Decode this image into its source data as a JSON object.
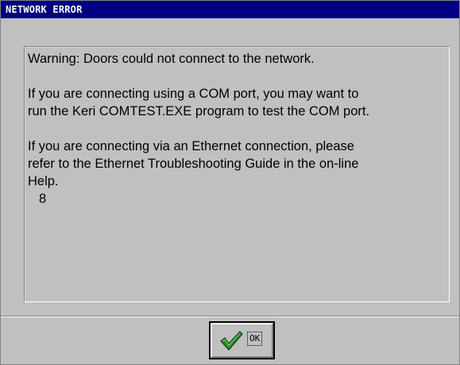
{
  "window": {
    "title": "NETWORK ERROR"
  },
  "message": {
    "line1": "Warning: Doors could not connect to the network.",
    "line2": "If you are connecting using a COM port, you may want to",
    "line3": "run the Keri COMTEST.EXE program to test the COM port.",
    "line4": "If you are connecting via an Ethernet connection, please",
    "line5": "refer to the Ethernet Troubleshooting Guide in the on-line",
    "line6": "Help.",
    "code": "8"
  },
  "ok_button": {
    "label": "OK",
    "icon": "checkmark-icon"
  },
  "colors": {
    "title_bar": "#000080",
    "window_bg": "#c0c0c0",
    "check_green": "#2e8b2e"
  }
}
